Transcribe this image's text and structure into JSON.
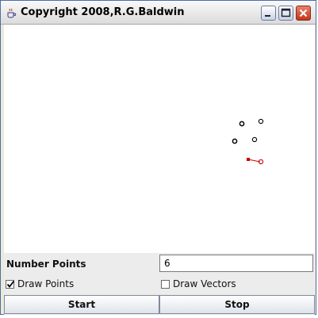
{
  "window": {
    "title": "Copyright 2008,R.G.Baldwin",
    "icon": "java-cup-icon"
  },
  "controls": {
    "number_points_label": "Number Points",
    "number_points_value": "6",
    "draw_points_label": "Draw Points",
    "draw_points_checked": true,
    "draw_vectors_label": "Draw Vectors",
    "draw_vectors_checked": false,
    "start_label": "Start",
    "stop_label": "Stop"
  },
  "colors": {
    "points": "#000000",
    "highlight": "#cc0000"
  }
}
